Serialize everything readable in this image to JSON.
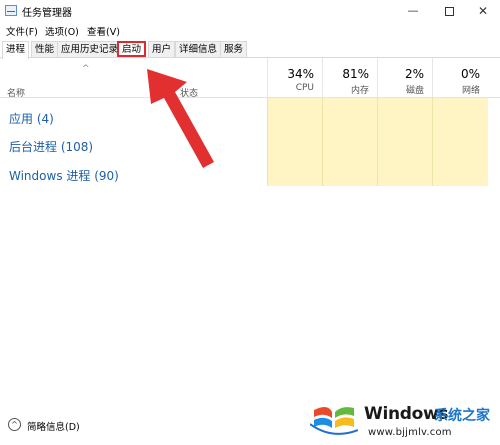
{
  "window": {
    "title": "任务管理器",
    "min_glyph": "—",
    "close_glyph": "✕"
  },
  "menu": [
    "文件(F)",
    "选项(O)",
    "查看(V)"
  ],
  "tabs": [
    "进程",
    "性能",
    "应用历史记录",
    "启动",
    "用户",
    "详细信息",
    "服务"
  ],
  "active_tab": "进程",
  "highlighted_tab": "启动",
  "header": {
    "sort_arrow": "^",
    "name": "名称",
    "status": "状态",
    "metrics": [
      {
        "pct": "34%",
        "label": "CPU"
      },
      {
        "pct": "81%",
        "label": "内存"
      },
      {
        "pct": "2%",
        "label": "磁盘"
      },
      {
        "pct": "0%",
        "label": "网络"
      }
    ]
  },
  "groups": [
    "应用 (4)",
    "后台进程 (108)",
    "Windows 进程 (90)"
  ],
  "footer": {
    "toggle_glyph": "^",
    "label": "简略信息(D)"
  },
  "watermark": {
    "brand": "Windows",
    "cn": "系统之家",
    "url": "www.bjjmlv.com"
  },
  "colors": {
    "highlight": "#e0282f",
    "group_link": "#1e5fa8",
    "heat_cell": "#fff4c4"
  }
}
